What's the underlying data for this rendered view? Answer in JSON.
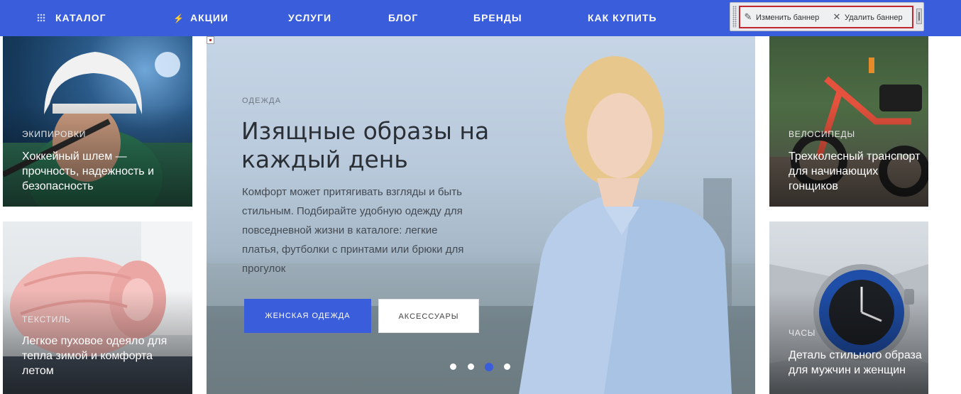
{
  "nav": {
    "items": [
      {
        "label": "КАТАЛОГ",
        "icon": "grid-icon"
      },
      {
        "label": "АКЦИИ",
        "icon": "lightning-icon"
      },
      {
        "label": "УСЛУГИ"
      },
      {
        "label": "БЛОГ"
      },
      {
        "label": "БРЕНДЫ"
      },
      {
        "label": "КАК КУПИТЬ"
      }
    ],
    "color": "#3a5ddb"
  },
  "admin": {
    "edit_label": "Изменить баннер",
    "delete_label": "Удалить баннер",
    "edit_icon": "pencil-icon",
    "delete_icon": "close-icon",
    "highlight_color": "#c0282d"
  },
  "cards": {
    "hockey": {
      "category": "ЭКИПИРОВКИ",
      "title": "Хоккейный шлем — прочность, надежность и безопасность"
    },
    "blanket": {
      "category": "ТЕКСТИЛЬ",
      "title": "Легкое пуховое одеяло для тепла зимой и комфорта летом"
    },
    "bikes": {
      "category": "ВЕЛОСИПЕДЫ",
      "title": "Трехколесный транспорт для начинающих гонщиков"
    },
    "watches": {
      "category": "ЧАСЫ",
      "title": "Деталь стильного образа для мужчин и женщин"
    }
  },
  "hero": {
    "eyebrow": "ОДЕЖДА",
    "headline": "Изящные образы на каждый день",
    "description": "Комфорт может притягивать взгляды и быть стильным. Подбирайте удобную одежду для повседневной жизни в каталоге: легкие платья, футболки с принтами или брюки для прогулок",
    "primary_button": "ЖЕНСКАЯ ОДЕЖДА",
    "secondary_button": "АКСЕССУАРЫ",
    "slides_total": 4,
    "active_slide": 3
  }
}
